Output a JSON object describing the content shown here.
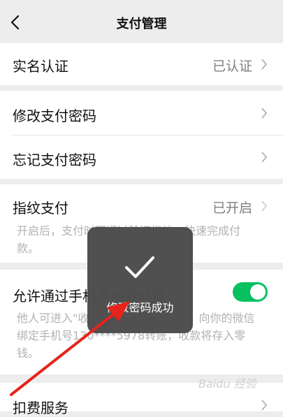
{
  "nav": {
    "title": "支付管理"
  },
  "realname": {
    "label": "实名认证",
    "value": "已认证"
  },
  "change_password": {
    "label": "修改支付密码"
  },
  "forgot_password": {
    "label": "忘记支付密码"
  },
  "fingerprint": {
    "label": "指纹支付",
    "value": "已开启",
    "description": "开启后，支付时可通过验证指纹，快速完成付款。"
  },
  "phone_transfer": {
    "label": "允许通过手机号向我转账",
    "description": "他人可进入\"收付款-向手机号转账\"，向你的微信绑定手机号130****5978转账，收款将存入零钱。",
    "enabled": true
  },
  "deduction": {
    "label": "扣费服务"
  },
  "toast": {
    "text": "修改密码成功",
    "icon": "checkmark-icon"
  },
  "watermark": {
    "text": "Baidu 经验"
  },
  "colors": {
    "toggle_on": "#07c160",
    "arrow": "#e8231a",
    "background": "#ededed"
  }
}
